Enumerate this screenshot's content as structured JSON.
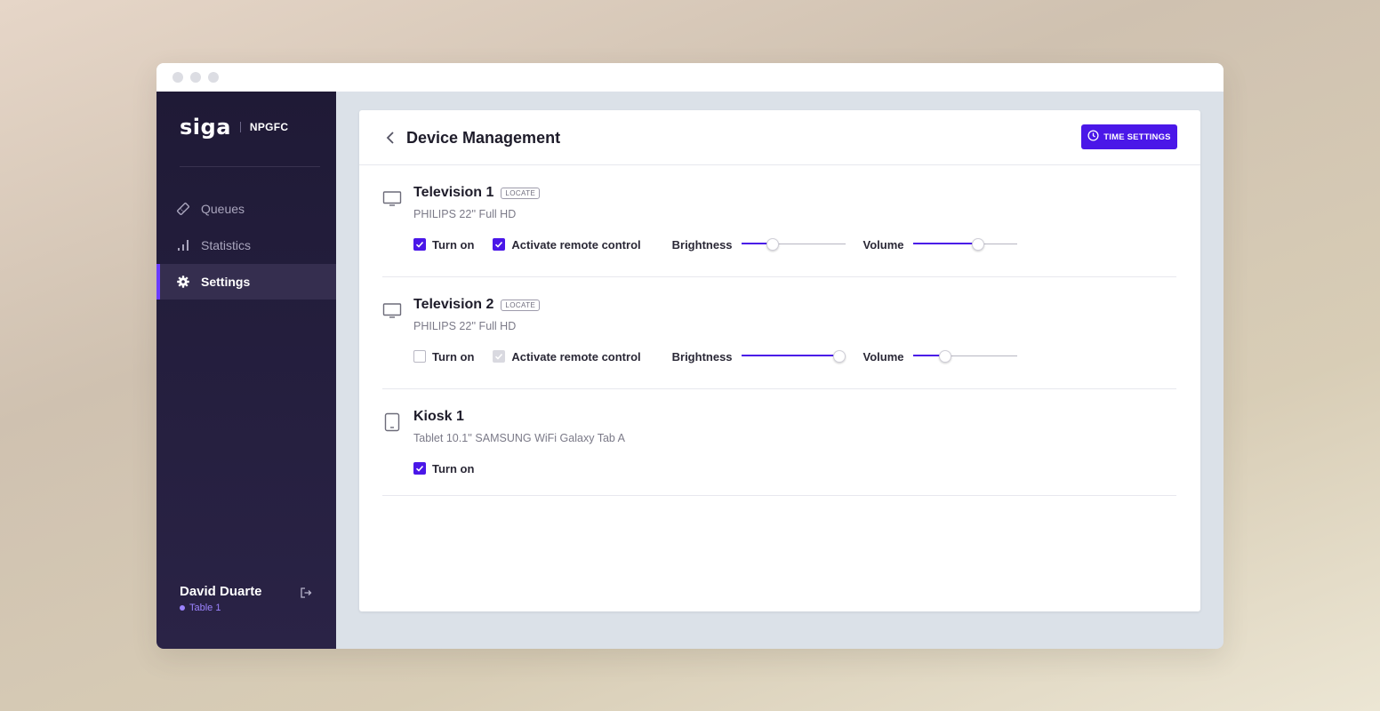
{
  "sidebar": {
    "logo": "siga",
    "org": "NPGFC",
    "items": [
      {
        "label": "Queues",
        "icon": "ticket-icon",
        "active": false
      },
      {
        "label": "Statistics",
        "icon": "bar-chart-icon",
        "active": false
      },
      {
        "label": "Settings",
        "icon": "gear-icon",
        "active": true
      }
    ],
    "user": {
      "name": "David Duarte",
      "table": "Table 1"
    }
  },
  "header": {
    "title": "Device Management",
    "time_settings_label": "TIME SETTINGS"
  },
  "devices": [
    {
      "name": "Television 1",
      "locate_label": "LOCATE",
      "model": "PHILIPS 22'' Full HD",
      "turn_on_label": "Turn on",
      "turn_on": true,
      "remote_label": "Activate remote control",
      "remote": true,
      "brightness_label": "Brightness",
      "brightness": 0.3,
      "volume_label": "Volume",
      "volume": 0.63
    },
    {
      "name": "Television 2",
      "locate_label": "LOCATE",
      "model": "PHILIPS 22'' Full HD",
      "turn_on_label": "Turn on",
      "turn_on": false,
      "remote_label": "Activate remote control",
      "remote": "disabled",
      "brightness_label": "Brightness",
      "brightness": 0.94,
      "volume_label": "Volume",
      "volume": 0.31
    },
    {
      "name": "Kiosk 1",
      "model": "Tablet 10.1'' SAMSUNG WiFi Galaxy Tab A",
      "turn_on_label": "Turn on",
      "turn_on": true
    }
  ],
  "colors": {
    "accent": "#4a17e8",
    "sidebar_bg": "#231d3c",
    "active_link": "#9c83ff"
  }
}
